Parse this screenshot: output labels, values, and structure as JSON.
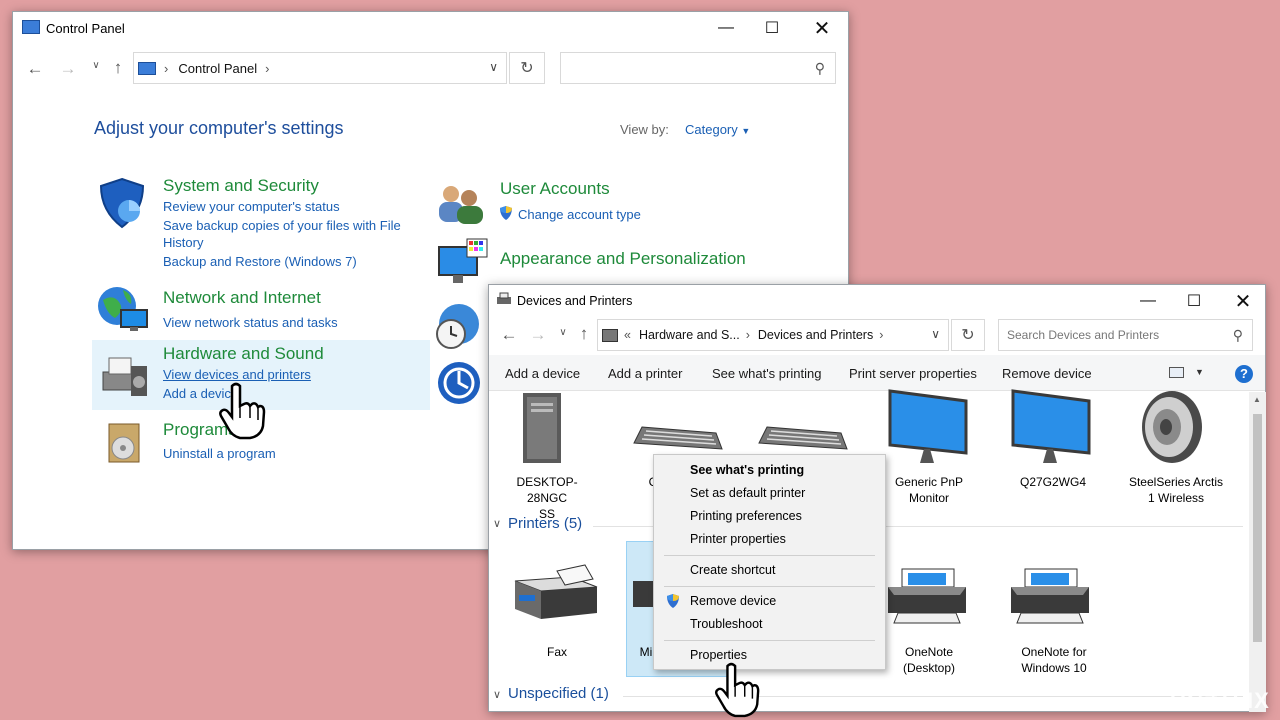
{
  "control_panel": {
    "title": "Control Panel",
    "address": "Control Panel",
    "heading": "Adjust your computer's settings",
    "view_by_label": "View by:",
    "view_by_value": "Category",
    "categories": [
      {
        "title": "System and Security",
        "links": [
          "Review your computer's status",
          "Save backup copies of your files with File",
          "History",
          "Backup and Restore (Windows 7)"
        ]
      },
      {
        "title": "Network and Internet",
        "links": [
          "View network status and tasks"
        ]
      },
      {
        "title": "Hardware and Sound",
        "links": [
          "View devices and printers",
          "Add a device"
        ]
      },
      {
        "title": "Programs",
        "links": [
          "Uninstall a program"
        ]
      },
      {
        "title": "User Accounts",
        "links": [
          "Change account type"
        ]
      },
      {
        "title": "Appearance and Personalization",
        "links": []
      }
    ]
  },
  "devices_window": {
    "title": "Devices and Printers",
    "breadcrumb": {
      "prefix": "«",
      "part1": "Hardware and S...",
      "part2": "Devices and Printers"
    },
    "search_placeholder": "Search Devices and Printers",
    "toolbar": [
      "Add a device",
      "Add a printer",
      "See what's printing",
      "Print server properties",
      "Remove device"
    ],
    "devices": [
      {
        "label": "DESKTOP-28NGC\nSS"
      },
      {
        "label": "C"
      },
      {
        "label": "Generic PnP\nMonitor"
      },
      {
        "label": "Q27G2WG4"
      },
      {
        "label": "SteelSeries Arctis\n1 Wireless"
      }
    ],
    "printers_group": "Printers (5)",
    "printers": [
      {
        "label": "Fax"
      },
      {
        "label": "Mi"
      },
      {
        "label": "OneNote\n(Desktop)"
      },
      {
        "label": "OneNote for\nWindows 10"
      }
    ],
    "unspecified_group": "Unspecified (1)"
  },
  "context_menu": {
    "items": [
      "See what's printing",
      "Set as default printer",
      "Printing preferences",
      "Printer properties",
      "Create shortcut",
      "Remove device",
      "Troubleshoot",
      "Properties"
    ]
  },
  "watermark": "UG≠TFIX"
}
